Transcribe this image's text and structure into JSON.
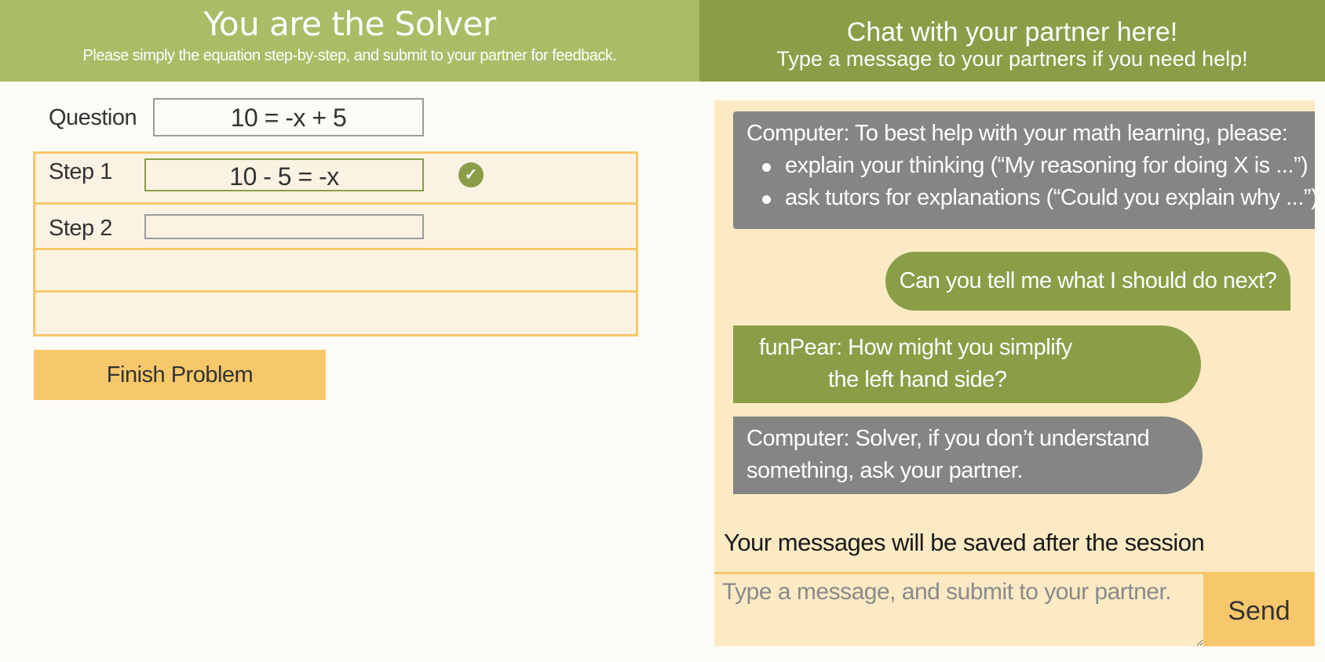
{
  "left_header": {
    "title": "You are the Solver",
    "subtitle": "Please simply the equation step-by-step, and submit to your partner for feedback."
  },
  "right_header": {
    "title": "Chat with your partner here!",
    "subtitle": "Type a message to your partners if you need help!"
  },
  "problem": {
    "question_label": "Question",
    "question_value": "10 = -x + 5",
    "steps": [
      {
        "label": "Step 1",
        "value": "10 - 5 = -x",
        "status": "correct"
      },
      {
        "label": "Step 2",
        "value": ""
      }
    ],
    "finish_label": "Finish Problem"
  },
  "chat": {
    "messages": [
      {
        "sender": "Computer",
        "intro": "Computer: To best help with your math learning, please:",
        "bullets": [
          "explain your thinking (“My reasoning for doing X is ...”)",
          "ask tutors for explanations (“Could you explain why ...”)"
        ]
      },
      {
        "sender": "user",
        "text": "Can you tell me what I should do next?"
      },
      {
        "sender": "funPear",
        "line1": "funPear: How might you simplify",
        "line2": "the left hand side?"
      },
      {
        "sender": "Computer",
        "line1": "Computer: Solver, if you don’t understand",
        "line2": "something, ask your partner."
      }
    ],
    "save_note": "Your messages will be saved after the session",
    "input_placeholder": "Type a message, and submit to your partner.",
    "send_label": "Send"
  },
  "colors": {
    "header_left": "#a8bd66",
    "header_right": "#8a9e48",
    "accent_yellow": "#f7c86b",
    "partner_bubble": "#8a9e48",
    "computer_bubble": "#858585",
    "chat_bg": "#fceac4"
  },
  "icons": {
    "step_status": "check-circle-icon"
  }
}
